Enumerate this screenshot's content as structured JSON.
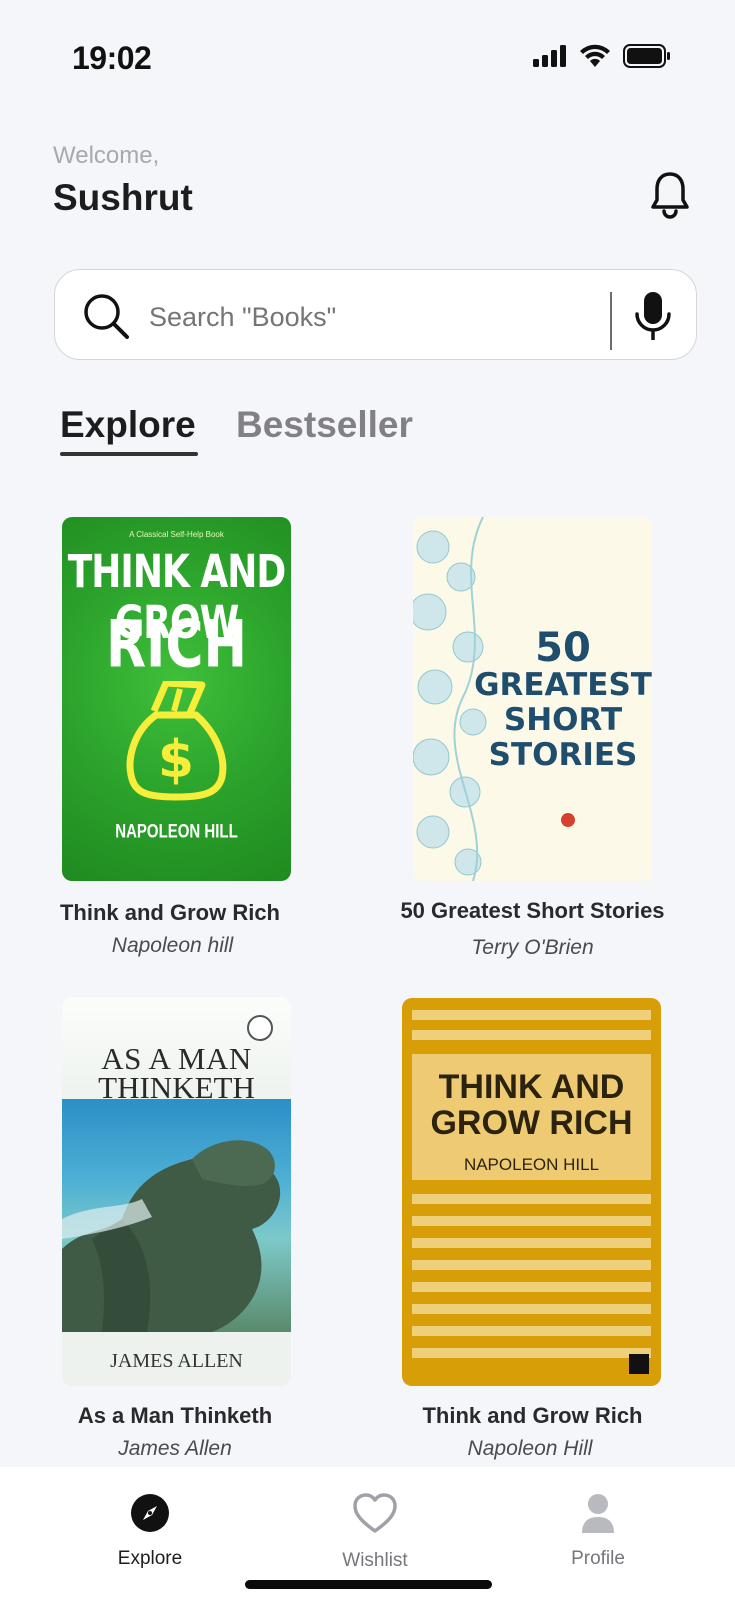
{
  "status_bar": {
    "time": "19:02"
  },
  "header": {
    "welcome": "Welcome,",
    "username": "Sushrut"
  },
  "search": {
    "placeholder": "Search \"Books\""
  },
  "tabs": [
    {
      "label": "Explore",
      "active": true
    },
    {
      "label": "Bestseller",
      "active": false
    }
  ],
  "books": [
    {
      "title": "Think and Grow Rich",
      "author": "Napoleon hill",
      "cover": {
        "tagline": "A Classical Self-Help Book",
        "title_line1": "THINK AND GROW",
        "title_line2": "RICH",
        "author": "NAPOLEON HILL",
        "color": "#2aa02a"
      }
    },
    {
      "title": "50 Greatest Short Stories",
      "author": "Terry O'Brien",
      "cover": {
        "line1": "50",
        "line2": "GREATEST",
        "line3": "SHORT",
        "line4": "STORIES",
        "color": "#fdf9e8"
      }
    },
    {
      "title": "As a Man Thinketh",
      "author": "James Allen",
      "cover": {
        "line1": "AS A MAN",
        "line2": "THINKETH",
        "author": "JAMES ALLEN"
      }
    },
    {
      "title": "Think and Grow Rich",
      "author": "Napoleon Hill",
      "cover": {
        "line1": "THINK AND",
        "line2": "GROW RICH",
        "author": "NAPOLEON HILL",
        "color": "#d89e08"
      }
    }
  ],
  "bottom_nav": [
    {
      "label": "Explore",
      "icon": "compass-icon",
      "active": true
    },
    {
      "label": "Wishlist",
      "icon": "heart-icon",
      "active": false
    },
    {
      "label": "Profile",
      "icon": "person-icon",
      "active": false
    }
  ]
}
